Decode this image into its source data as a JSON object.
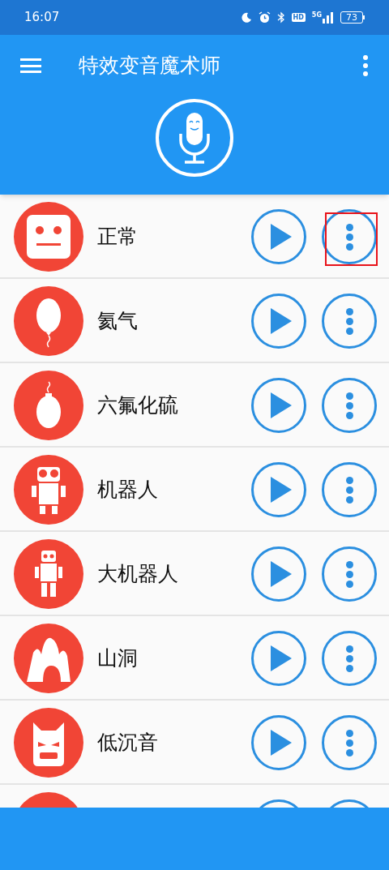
{
  "status_bar": {
    "time": "16:07",
    "network_badge": "HD",
    "network_type": "5G",
    "battery": "73"
  },
  "app_bar": {
    "title": "特效变音魔术师"
  },
  "effects": [
    {
      "name": "正常",
      "kind": "face",
      "more_highlighted": true
    },
    {
      "name": "氦气",
      "kind": "balloon",
      "more_highlighted": false
    },
    {
      "name": "六氟化硫",
      "kind": "bomb",
      "more_highlighted": false
    },
    {
      "name": "机器人",
      "kind": "robot",
      "more_highlighted": false
    },
    {
      "name": "大机器人",
      "kind": "tall-robot",
      "more_highlighted": false
    },
    {
      "name": "山洞",
      "kind": "cave",
      "more_highlighted": false
    },
    {
      "name": "低沉音",
      "kind": "mask",
      "more_highlighted": false
    },
    {
      "kind": "blank"
    }
  ]
}
